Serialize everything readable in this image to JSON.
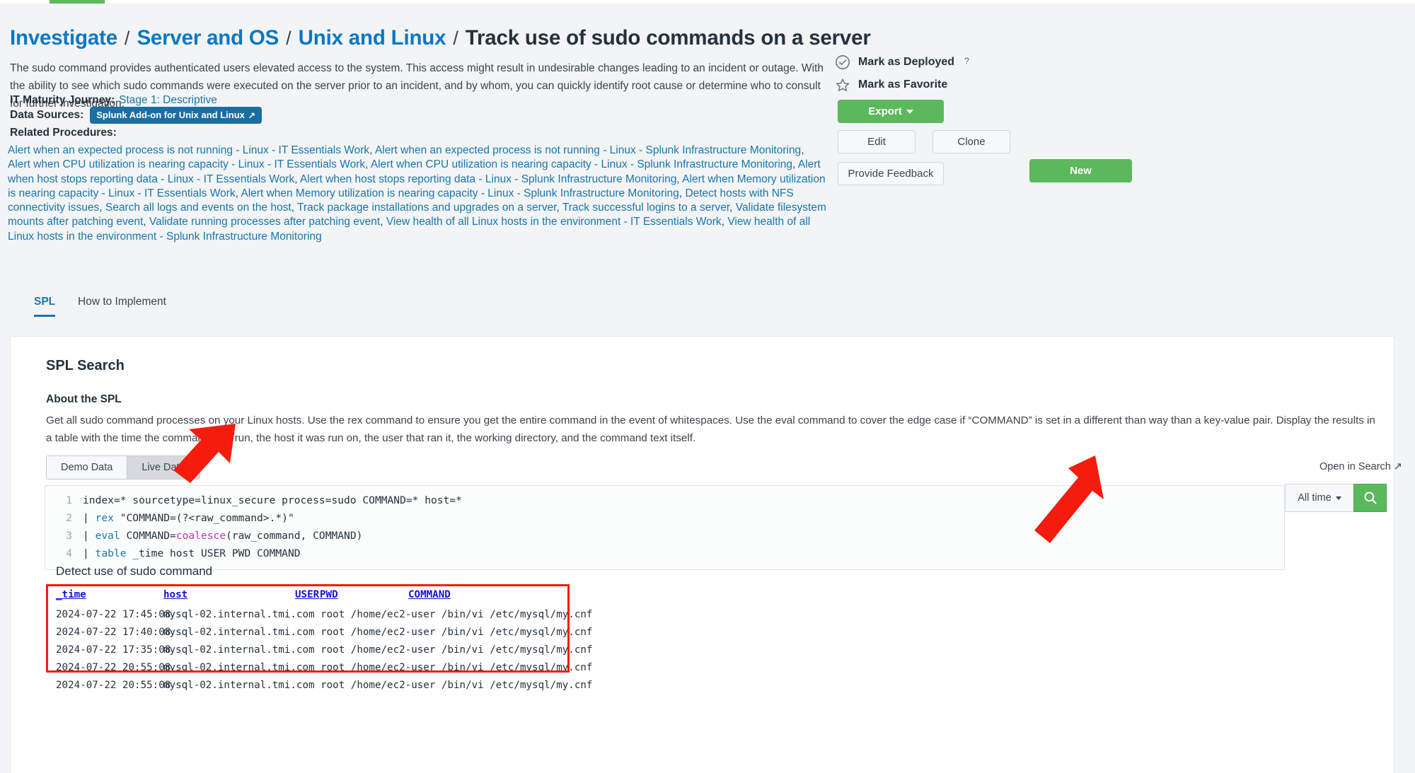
{
  "breadcrumb": {
    "links": [
      "Investigate",
      "Server and OS",
      "Unix and Linux"
    ],
    "separator": "/",
    "current": "Track use of sudo commands on a server"
  },
  "description": "The sudo command provides authenticated users elevated access to the system. This access might result in undesirable changes leading to an incident or outage. With the ability to see which sudo commands were executed on the server prior to an incident, and by whom, you can quickly identify root cause or determine who to consult for further investigation.",
  "maturity": {
    "label": "IT Maturity Journey:",
    "value": "Stage 1: Descriptive"
  },
  "data_sources": {
    "label": "Data Sources:",
    "badge": "Splunk Add-on for Unix and Linux",
    "badge_icon": "external-link-icon"
  },
  "related_procedures": {
    "title": "Related Procedures:",
    "items": [
      "Alert when an expected process is not running - Linux - IT Essentials Work",
      "Alert when an expected process is not running - Linux - Splunk Infrastructure Monitoring",
      "Alert when CPU utilization is nearing capacity - Linux - IT Essentials Work",
      "Alert when CPU utilization is nearing capacity - Linux - Splunk Infrastructure Monitoring",
      "Alert when host stops reporting data - Linux - IT Essentials Work",
      "Alert when host stops reporting data - Linux - Splunk Infrastructure Monitoring",
      "Alert when Memory utilization is nearing capacity - Linux - IT Essentials Work",
      "Alert when Memory utilization is nearing capacity - Linux - Splunk Infrastructure Monitoring",
      "Detect hosts with NFS connectivity issues",
      "Search all logs and events on the host",
      "Track package installations and upgrades on a server",
      "Track successful logins to a server",
      "Validate filesystem mounts after patching event",
      "Validate running processes after patching event",
      "View health of all Linux hosts in the environment - IT Essentials Work",
      "View health of all Linux hosts in the environment - Splunk Infrastructure Monitoring"
    ]
  },
  "actions": {
    "mark_deployed": {
      "label": "Mark as Deployed",
      "help": "?",
      "icon": "check-circle-icon"
    },
    "mark_favorite": {
      "label": "Mark as Favorite",
      "icon": "star-icon"
    },
    "export": "Export",
    "edit": "Edit",
    "clone": "Clone",
    "new": "New",
    "feedback": "Provide Feedback"
  },
  "tabs": [
    {
      "label": "SPL",
      "active": true
    },
    {
      "label": "How to Implement",
      "active": false
    }
  ],
  "spl_panel": {
    "title": "SPL Search",
    "about_title": "About the SPL",
    "about_body": "Get all sudo command processes on your Linux hosts. Use the rex command to ensure you get the entire command in the event of whitespaces. Use the eval command to cover the edge case if “COMMAND” is set in a different than way than a key-value pair. Display the results in a table with the time the command was run, the host it was run on, the user that ran it, the working directory, and the command text itself.",
    "toggle": {
      "demo": "Demo Data",
      "live": "Live Data",
      "selected": "Live Data"
    },
    "open_in_search": "Open in Search",
    "open_in_search_icon": "external-link-icon",
    "time_range": "All time",
    "search_icon": "magnifier-icon",
    "code_lines": [
      {
        "n": "1",
        "text": "index=* sourcetype=linux_secure process=sudo COMMAND=* host=*"
      },
      {
        "n": "2",
        "text": "| rex \"COMMAND=(?<raw_command>.*)\""
      },
      {
        "n": "3",
        "text": "| eval COMMAND=coalesce(raw_command, COMMAND)"
      },
      {
        "n": "4",
        "text": "| table _time host USER PWD COMMAND"
      }
    ]
  },
  "results": {
    "title": "Detect use of sudo command",
    "columns": [
      "_time",
      "host",
      "USER",
      "PWD",
      "COMMAND"
    ],
    "rows": [
      [
        "2024-07-22 17:45:08",
        "mysql-02.internal.tmi.com",
        "root",
        "/home/ec2-user",
        "/bin/vi /etc/mysql/my.cnf"
      ],
      [
        "2024-07-22 17:40:08",
        "mysql-02.internal.tmi.com",
        "root",
        "/home/ec2-user",
        "/bin/vi /etc/mysql/my.cnf"
      ],
      [
        "2024-07-22 17:35:08",
        "mysql-02.internal.tmi.com",
        "root",
        "/home/ec2-user",
        "/bin/vi /etc/mysql/my.cnf"
      ],
      [
        "2024-07-22 20:55:08",
        "mysql-02.internal.tmi.com",
        "root",
        "/home/ec2-user",
        "/bin/vi /etc/mysql/my.cnf"
      ],
      [
        "2024-07-22 20:55:08",
        "mysql-02.internal.tmi.com",
        "root",
        "/home/ec2-user",
        "/bin/vi /etc/mysql/my.cnf"
      ]
    ]
  },
  "colors": {
    "link": "#1b75ab",
    "crumb_link": "#0877c6",
    "green": "#5cb85c",
    "badge": "#1a6ea3",
    "annotation_red": "#f41c0c",
    "table_header_link": "#1414d2"
  }
}
